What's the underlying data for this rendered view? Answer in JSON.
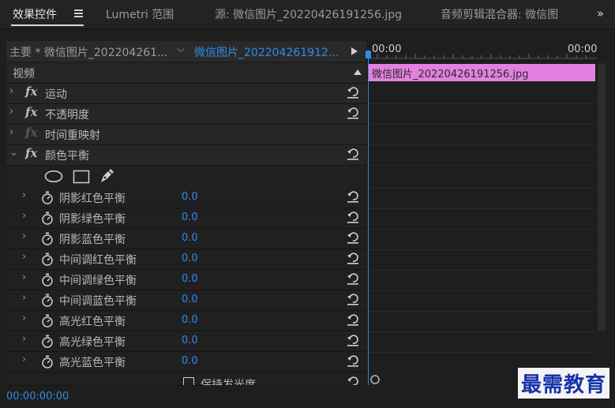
{
  "tabs": {
    "effect_controls": "效果控件",
    "lumetri_scope": "Lumetri 范围",
    "source": "源: 微信图片_20220426191256.jpg",
    "audio_mixer": "音频剪辑混合器: 微信图"
  },
  "sequence": {
    "master": "主要 * 微信图片_202204261...",
    "clip": "微信图片_202204261912..."
  },
  "section_video": "视频",
  "effects": [
    {
      "label": "运动"
    },
    {
      "label": "不透明度"
    },
    {
      "label": "时间重映射"
    },
    {
      "label": "颜色平衡"
    }
  ],
  "params": [
    {
      "label": "阴影红色平衡",
      "value": "0.0"
    },
    {
      "label": "阴影绿色平衡",
      "value": "0.0"
    },
    {
      "label": "阴影蓝色平衡",
      "value": "0.0"
    },
    {
      "label": "中间调红色平衡",
      "value": "0.0"
    },
    {
      "label": "中间调绿色平衡",
      "value": "0.0"
    },
    {
      "label": "中间调蓝色平衡",
      "value": "0.0"
    },
    {
      "label": "高光红色平衡",
      "value": "0.0"
    },
    {
      "label": "高光绿色平衡",
      "value": "0.0"
    },
    {
      "label": "高光蓝色平衡",
      "value": "0.0"
    }
  ],
  "preserve_label": "保持发光度",
  "timeline": {
    "tc_start": "00:00",
    "tc_end": "00:00",
    "clip_label": "微信图片_20220426191256.jpg"
  },
  "current_time": "00:00:00:00",
  "watermark": "最需教育",
  "colors": {
    "accent": "#2d8ceb",
    "clip": "#e281e0"
  }
}
